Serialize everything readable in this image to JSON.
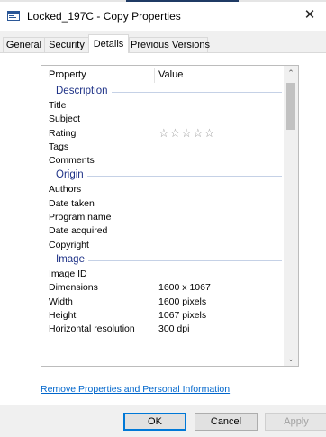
{
  "window": {
    "title": "Locked_197C - Copy Properties",
    "close_glyph": "✕",
    "icon": "file-properties-icon"
  },
  "tabs": [
    {
      "label": "General",
      "active": false
    },
    {
      "label": "Security",
      "active": false
    },
    {
      "label": "Details",
      "active": true
    },
    {
      "label": "Previous Versions",
      "active": false
    }
  ],
  "list": {
    "header": {
      "property": "Property",
      "value": "Value"
    },
    "rows": [
      {
        "group": "Description"
      },
      {
        "name": "Title",
        "value": ""
      },
      {
        "name": "Subject",
        "value": ""
      },
      {
        "name": "Rating",
        "value": "",
        "stars": "☆☆☆☆☆"
      },
      {
        "name": "Tags",
        "value": ""
      },
      {
        "name": "Comments",
        "value": ""
      },
      {
        "group": "Origin"
      },
      {
        "name": "Authors",
        "value": ""
      },
      {
        "name": "Date taken",
        "value": ""
      },
      {
        "name": "Program name",
        "value": ""
      },
      {
        "name": "Date acquired",
        "value": ""
      },
      {
        "name": "Copyright",
        "value": ""
      },
      {
        "group": "Image"
      },
      {
        "name": "Image ID",
        "value": ""
      },
      {
        "name": "Dimensions",
        "value": "1600 x 1067"
      },
      {
        "name": "Width",
        "value": "1600 pixels"
      },
      {
        "name": "Height",
        "value": "1067 pixels"
      },
      {
        "name": "Horizontal resolution",
        "value": "300 dpi"
      }
    ],
    "scroll_up_glyph": "⌃",
    "scroll_down_glyph": "⌄"
  },
  "links": {
    "remove_properties": "Remove Properties and Personal Information"
  },
  "buttons": {
    "ok": "OK",
    "cancel": "Cancel",
    "apply": "Apply"
  },
  "colors": {
    "group_title": "#1e3287",
    "link": "#0066cc",
    "default_button_border": "#0078d7",
    "dialog_bg": "#f0f0f0"
  }
}
